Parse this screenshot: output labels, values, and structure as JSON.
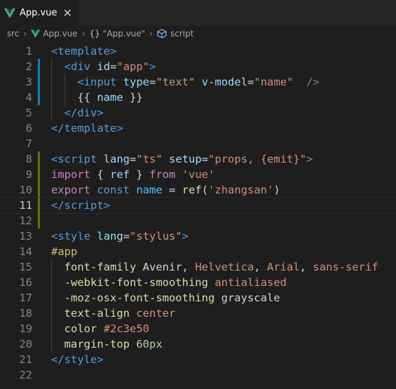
{
  "tab": {
    "label": "App.vue",
    "close": "✕"
  },
  "breadcrumb": {
    "parts": [
      "src",
      "App.vue",
      "\"App.vue\"",
      "script"
    ],
    "braces": "{}"
  },
  "colors": {
    "modified_bar": "#1b81a8",
    "added_bar": "#587c0c",
    "accent_vue": "#41b883"
  },
  "lines": [
    {
      "n": "1",
      "tokens": [
        [
          "tag",
          "<"
        ],
        [
          "tag",
          "template"
        ],
        [
          "tag",
          ">"
        ]
      ]
    },
    {
      "n": "2",
      "tokens": [
        [
          "plain",
          "  "
        ],
        [
          "tag",
          "<"
        ],
        [
          "tag",
          "div"
        ],
        [
          "plain",
          " "
        ],
        [
          "attr",
          "id"
        ],
        [
          "plain",
          "="
        ],
        [
          "str",
          "\"app\""
        ],
        [
          "tag",
          ">"
        ]
      ]
    },
    {
      "n": "3",
      "tokens": [
        [
          "plain",
          "    "
        ],
        [
          "tag",
          "<"
        ],
        [
          "tag",
          "input"
        ],
        [
          "plain",
          " "
        ],
        [
          "attr",
          "type"
        ],
        [
          "plain",
          "="
        ],
        [
          "str",
          "\"text\""
        ],
        [
          "plain",
          " "
        ],
        [
          "attr",
          "v-model"
        ],
        [
          "plain",
          "="
        ],
        [
          "str",
          "\"name\""
        ],
        [
          "plain",
          "  "
        ],
        [
          "punct",
          "/>"
        ]
      ]
    },
    {
      "n": "4",
      "tokens": [
        [
          "plain",
          "    "
        ],
        [
          "text",
          "{{ "
        ],
        [
          "attr",
          "name"
        ],
        [
          "text",
          " }}"
        ]
      ]
    },
    {
      "n": "5",
      "tokens": [
        [
          "plain",
          "  "
        ],
        [
          "tag",
          "</"
        ],
        [
          "tag",
          "div"
        ],
        [
          "tag",
          ">"
        ]
      ]
    },
    {
      "n": "6",
      "tokens": [
        [
          "tag",
          "</"
        ],
        [
          "tag",
          "template"
        ],
        [
          "tag",
          ">"
        ]
      ]
    },
    {
      "n": "7",
      "tokens": []
    },
    {
      "n": "8",
      "tokens": [
        [
          "tag",
          "<"
        ],
        [
          "tag",
          "script"
        ],
        [
          "plain",
          " "
        ],
        [
          "attr",
          "lang"
        ],
        [
          "plain",
          "="
        ],
        [
          "str",
          "\"ts\""
        ],
        [
          "plain",
          " "
        ],
        [
          "attr",
          "setup"
        ],
        [
          "plain",
          "="
        ],
        [
          "str",
          "\"props, {emit}\""
        ],
        [
          "tag",
          ">"
        ]
      ]
    },
    {
      "n": "9",
      "tokens": [
        [
          "kw",
          "import"
        ],
        [
          "plain",
          " { "
        ],
        [
          "attr",
          "ref"
        ],
        [
          "plain",
          " } "
        ],
        [
          "kw",
          "from"
        ],
        [
          "plain",
          " "
        ],
        [
          "str",
          "'vue'"
        ]
      ]
    },
    {
      "n": "10",
      "tokens": [
        [
          "kw",
          "export"
        ],
        [
          "plain",
          " "
        ],
        [
          "kw2",
          "const"
        ],
        [
          "plain",
          " "
        ],
        [
          "var",
          "name"
        ],
        [
          "plain",
          " = "
        ],
        [
          "fn",
          "ref"
        ],
        [
          "plain",
          "("
        ],
        [
          "str",
          "'zhangsan'"
        ],
        [
          "plain",
          ")"
        ]
      ]
    },
    {
      "n": "11",
      "tokens": [
        [
          "tag",
          "</"
        ],
        [
          "tag",
          "script"
        ],
        [
          "tag",
          ">"
        ]
      ]
    },
    {
      "n": "12",
      "tokens": []
    },
    {
      "n": "13",
      "tokens": [
        [
          "tag",
          "<"
        ],
        [
          "tag",
          "style"
        ],
        [
          "plain",
          " "
        ],
        [
          "attr",
          "lang"
        ],
        [
          "plain",
          "="
        ],
        [
          "str",
          "\"stylus\""
        ],
        [
          "tag",
          ">"
        ]
      ]
    },
    {
      "n": "14",
      "tokens": [
        [
          "sel",
          "#app"
        ]
      ]
    },
    {
      "n": "15",
      "tokens": [
        [
          "plain",
          "  "
        ],
        [
          "yellow",
          "font-family"
        ],
        [
          "plain",
          " Avenir, "
        ],
        [
          "val",
          "Helvetica"
        ],
        [
          "plain",
          ", "
        ],
        [
          "val",
          "Arial"
        ],
        [
          "plain",
          ", "
        ],
        [
          "val",
          "sans-serif"
        ]
      ]
    },
    {
      "n": "16",
      "tokens": [
        [
          "plain",
          "  "
        ],
        [
          "yellow",
          "-webkit-font-smoothing"
        ],
        [
          "plain",
          " "
        ],
        [
          "val",
          "antialiased"
        ]
      ]
    },
    {
      "n": "17",
      "tokens": [
        [
          "plain",
          "  "
        ],
        [
          "yellow",
          "-moz-osx-font-smoothing"
        ],
        [
          "plain",
          " grayscale"
        ]
      ]
    },
    {
      "n": "18",
      "tokens": [
        [
          "plain",
          "  "
        ],
        [
          "yellow",
          "text-align"
        ],
        [
          "plain",
          " "
        ],
        [
          "val",
          "center"
        ]
      ]
    },
    {
      "n": "19",
      "tokens": [
        [
          "plain",
          "  "
        ],
        [
          "yellow",
          "color"
        ],
        [
          "plain",
          " "
        ],
        [
          "val",
          "#2c3e50"
        ]
      ]
    },
    {
      "n": "20",
      "tokens": [
        [
          "plain",
          "  "
        ],
        [
          "yellow",
          "margin-top"
        ],
        [
          "plain",
          " "
        ],
        [
          "num",
          "60px"
        ]
      ]
    },
    {
      "n": "21",
      "tokens": [
        [
          "tag",
          "</"
        ],
        [
          "tag",
          "style"
        ],
        [
          "tag",
          ">"
        ]
      ]
    },
    {
      "n": "22",
      "tokens": []
    }
  ],
  "current_line": "11",
  "modified_lines": [
    "2",
    "3",
    "4"
  ],
  "added_lines": [
    "8",
    "9",
    "10",
    "11",
    "12"
  ]
}
